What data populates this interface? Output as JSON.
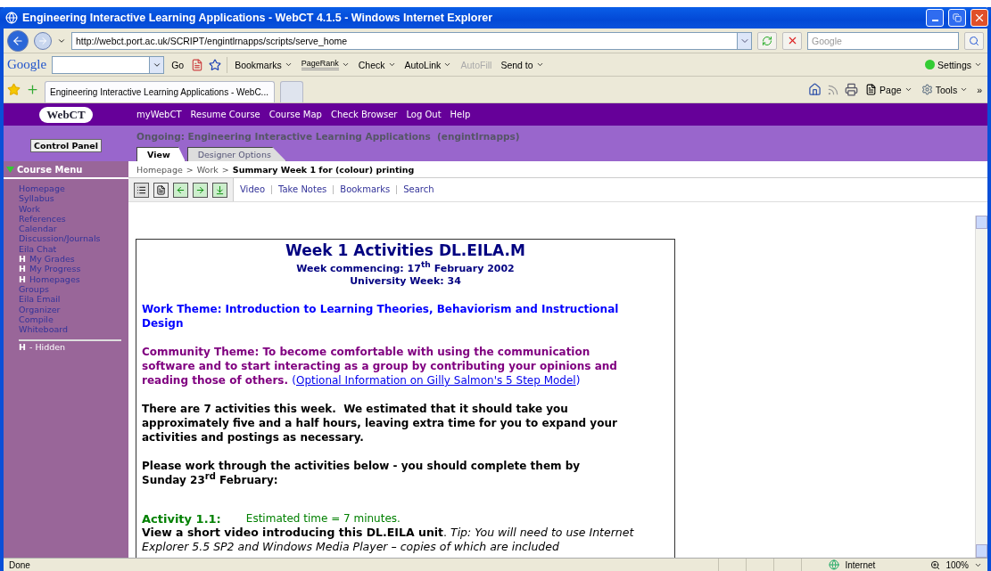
{
  "window": {
    "title": "Engineering Interactive Learning Applications - WebCT 4.1.5 - Windows Internet Explorer"
  },
  "address_bar": {
    "url": "http://webct.port.ac.uk/SCRIPT/engintlrnapps/scripts/serve_home",
    "search_placeholder": "Google"
  },
  "google_toolbar": {
    "logo": "Google",
    "go": "Go",
    "settings": "Settings",
    "items": [
      {
        "kind": "menu",
        "label": "Bookmarks",
        "disabled": false
      },
      {
        "kind": "pagerank",
        "label": "PageRank",
        "disabled": false
      },
      {
        "kind": "split",
        "label": "Check",
        "disabled": false
      },
      {
        "kind": "split",
        "label": "AutoLink",
        "disabled": false
      },
      {
        "kind": "plain",
        "label": "AutoFill",
        "disabled": true
      },
      {
        "kind": "menu",
        "label": "Send to",
        "disabled": false
      }
    ]
  },
  "browser_tabs": [
    {
      "label": "Engineering Interactive Learning Applications - WebC...",
      "selected": true
    }
  ],
  "command_bar": {
    "page": "Page",
    "tools": "Tools",
    "more": "»"
  },
  "webct": {
    "logo": "WebCT",
    "links": [
      "myWebCT",
      "Resume Course",
      "Course Map",
      "Check Browser",
      "Log Out",
      "Help"
    ],
    "control_panel": "Control Panel",
    "course_title": "Ongoing: Engineering Interactive Learning Applications  (engintlrnapps)",
    "tabs": [
      {
        "label": "View",
        "selected": true
      },
      {
        "label": "Designer Options",
        "selected": false
      }
    ]
  },
  "course_menu": {
    "title": "Course Menu",
    "legend": {
      "marker": "H",
      "text": "- Hidden"
    },
    "items": [
      {
        "label": "Homepage",
        "hidden": false
      },
      {
        "label": "Syllabus",
        "hidden": false
      },
      {
        "label": "Work",
        "hidden": false
      },
      {
        "label": "References",
        "hidden": false
      },
      {
        "label": "Calendar",
        "hidden": false
      },
      {
        "label": "Discussion/Journals",
        "hidden": false
      },
      {
        "label": "Eila Chat",
        "hidden": false
      },
      {
        "label": "My Grades",
        "hidden": true,
        "marker": "H"
      },
      {
        "label": "My Progress",
        "hidden": true,
        "marker": "H"
      },
      {
        "label": "Homepages",
        "hidden": true,
        "marker": "H"
      },
      {
        "label": "Groups",
        "hidden": false
      },
      {
        "label": "Eila Email",
        "hidden": false
      },
      {
        "label": "Organizer",
        "hidden": false
      },
      {
        "label": "Compile",
        "hidden": false
      },
      {
        "label": "Whiteboard",
        "hidden": false
      }
    ]
  },
  "breadcrumb": {
    "path": [
      "Homepage",
      "Work"
    ],
    "separator": ">",
    "current": "Summary Week 1 for (colour) printing"
  },
  "page_tools": {
    "links": [
      "Video",
      "Take Notes",
      "Bookmarks",
      "Search"
    ]
  },
  "document": {
    "title": "Week 1 Activities DL.EILA.M",
    "subtitle": [
      "Week commencing: 17$^{th}$ February 2002",
      "University Week: 34"
    ],
    "work_theme": "Work Theme: Introduction to Learning Theories, Behaviorism and Instructional Design",
    "community_theme": {
      "text": "Community Theme: To become comfortable with using the communication software and to start interacting as a group by contributing your opinions and reading those of others.",
      "link_open": "(",
      "link": "Optional Information on Gilly Salmon's 5 Step Model",
      "link_close": ")"
    },
    "paragraphs": [
      "There are 7 activities this week.  We estimated that it should take you approximately five and a half hours, leaving extra time for you to expand your activities and postings as necessary.",
      "Please work through the activities below - you should complete them by Sunday 23$^{rd}$ February:"
    ],
    "activities": [
      {
        "label": "Activity 1.1:",
        "estimate": "Estimated time = 7 minutes.",
        "description": "**View a short video introducing this DL.EILA unit**. *Tip: You will need to use Internet Explorer 5.5 SP2 and Windows Media Player – copies of which are included*"
      }
    ]
  },
  "status_bar": {
    "text": "Done",
    "zone": "Internet",
    "zoom": "100%"
  }
}
